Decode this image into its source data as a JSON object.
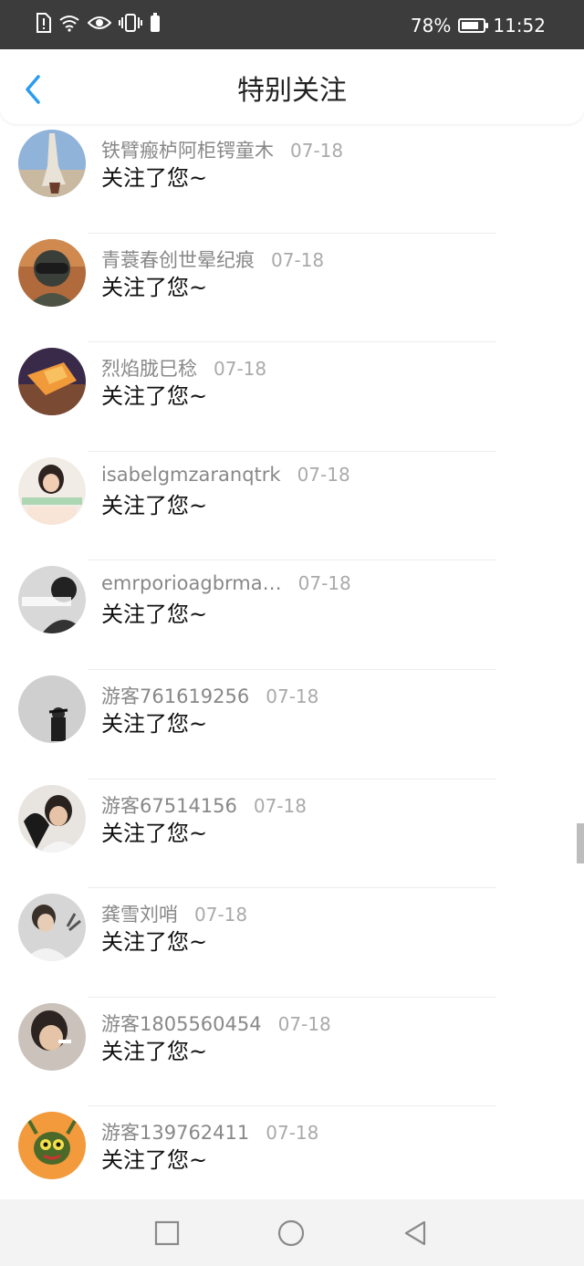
{
  "status": {
    "battery_text": "78%",
    "time": "11:52",
    "icons": [
      "alert-icon",
      "wifi-icon",
      "eye-icon",
      "vibrate-icon",
      "battery-small-icon"
    ]
  },
  "header": {
    "title": "特别关注",
    "back_icon": "back-chevron-icon"
  },
  "items": [
    {
      "name": "铁臂瘢栌阿柜锷童木",
      "date": "07-18",
      "msg": "关注了您~",
      "avatar": "avatar-1"
    },
    {
      "name": "青蓑春创世晕纪痕",
      "date": "07-18",
      "msg": "关注了您~",
      "avatar": "avatar-2"
    },
    {
      "name": "烈焰胧巳稔",
      "date": "07-18",
      "msg": "关注了您~",
      "avatar": "avatar-3"
    },
    {
      "name": "isabelgmzaranqtrk",
      "date": "07-18",
      "msg": "关注了您~",
      "avatar": "avatar-4"
    },
    {
      "name": "emrporioagbrma…",
      "date": "07-18",
      "msg": "关注了您~",
      "avatar": "avatar-5"
    },
    {
      "name": "游客761619256",
      "date": "07-18",
      "msg": "关注了您~",
      "avatar": "avatar-6"
    },
    {
      "name": "游客67514156",
      "date": "07-18",
      "msg": "关注了您~",
      "avatar": "avatar-7"
    },
    {
      "name": "龚雪刘哨",
      "date": "07-18",
      "msg": "关注了您~",
      "avatar": "avatar-8"
    },
    {
      "name": "游客1805560454",
      "date": "07-18",
      "msg": "关注了您~",
      "avatar": "avatar-9"
    },
    {
      "name": "游客139762411",
      "date": "07-18",
      "msg": "关注了您~",
      "avatar": "avatar-10"
    }
  ],
  "nav": {
    "icons": [
      "square-recent-icon",
      "circle-home-icon",
      "triangle-back-icon"
    ]
  },
  "colors": {
    "accent": "#2b9cf0",
    "status_bar": "#3c3c3c",
    "name_text": "#888888",
    "msg_text": "#111111"
  }
}
